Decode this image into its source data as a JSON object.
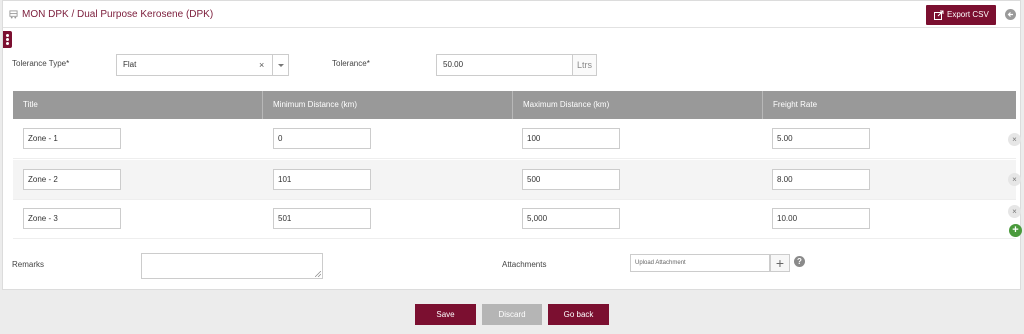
{
  "header": {
    "title": "MON DPK / Dual Purpose Kerosene (DPK)",
    "export_label": "Export CSV"
  },
  "form": {
    "tolerance_type_label": "Tolerance Type",
    "tolerance_type_value": "Flat",
    "clear_glyph": "×",
    "tolerance_label": "Tolerance",
    "tolerance_value": "50.00",
    "tolerance_unit": "Ltrs",
    "required_mark": "*"
  },
  "table": {
    "columns": [
      "Title",
      "Minimum Distance (km)",
      "Maximum Distance (km)",
      "Freight Rate"
    ],
    "rows": [
      {
        "title": "Zone - 1",
        "min": "0",
        "max": "100",
        "rate": "5.00"
      },
      {
        "title": "Zone - 2",
        "min": "101",
        "max": "500",
        "rate": "8.00"
      },
      {
        "title": "Zone - 3",
        "min": "501",
        "max": "5,000",
        "rate": "10.00"
      }
    ],
    "remove_glyph": "×",
    "add_glyph": "+"
  },
  "footer_fields": {
    "remarks_label": "Remarks",
    "remarks_value": "",
    "attachments_label": "Attachments",
    "upload_placeholder": "Upload Attachment",
    "upload_glyph": "+",
    "help_glyph": "?"
  },
  "actions": {
    "save": "Save",
    "discard": "Discard",
    "go_back": "Go back"
  },
  "colors": {
    "brand": "#7b0f30",
    "header_title": "#7b1c3a",
    "table_header": "#999999",
    "add": "#4a9a3c",
    "discard": "#b5b5b5"
  }
}
